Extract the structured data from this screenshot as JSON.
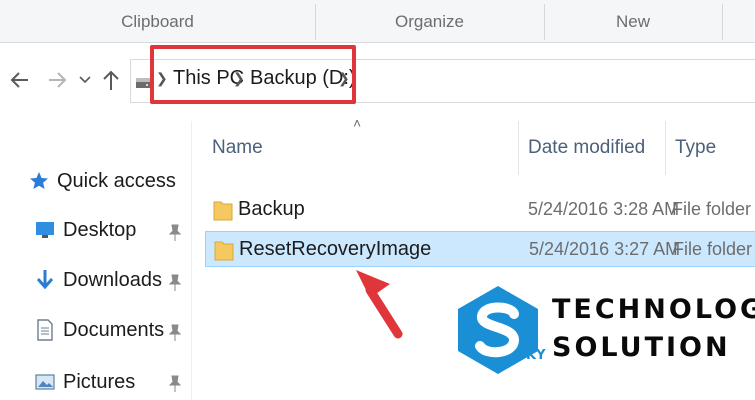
{
  "ribbon": {
    "groups": [
      "Clipboard",
      "Organize",
      "New"
    ]
  },
  "nav": {
    "back_icon": "arrow-left-icon",
    "forward_icon": "arrow-right-icon",
    "recent_icon": "chevron-down-icon",
    "up_icon": "arrow-up-icon"
  },
  "address": {
    "crumbs": [
      "This PC",
      "Backup (D:)"
    ],
    "drive_icon": "drive-icon"
  },
  "sidebar": {
    "items": [
      {
        "label": "Quick access",
        "icon": "star-icon"
      },
      {
        "label": "Desktop",
        "icon": "desktop-icon",
        "pinned": true
      },
      {
        "label": "Downloads",
        "icon": "download-icon",
        "pinned": true
      },
      {
        "label": "Documents",
        "icon": "document-icon",
        "pinned": true
      },
      {
        "label": "Pictures",
        "icon": "picture-icon",
        "pinned": true
      }
    ]
  },
  "columns": {
    "name": "Name",
    "date": "Date modified",
    "type": "Type"
  },
  "files": [
    {
      "name": "Backup",
      "date": "5/24/2016 3:28 AM",
      "type": "File folder",
      "selected": false
    },
    {
      "name": "ResetRecoveryImage",
      "date": "5/24/2016 3:27 AM",
      "type": "File folder",
      "selected": true
    }
  ],
  "watermark": {
    "line1": "TECHNOLOGY",
    "line2": "SOLUTION",
    "badge": "KY"
  },
  "colors": {
    "highlight": "#e0353b",
    "selection": "#cce8ff",
    "folder": "#f5c960",
    "logo_blue": "#1b8fd6"
  }
}
